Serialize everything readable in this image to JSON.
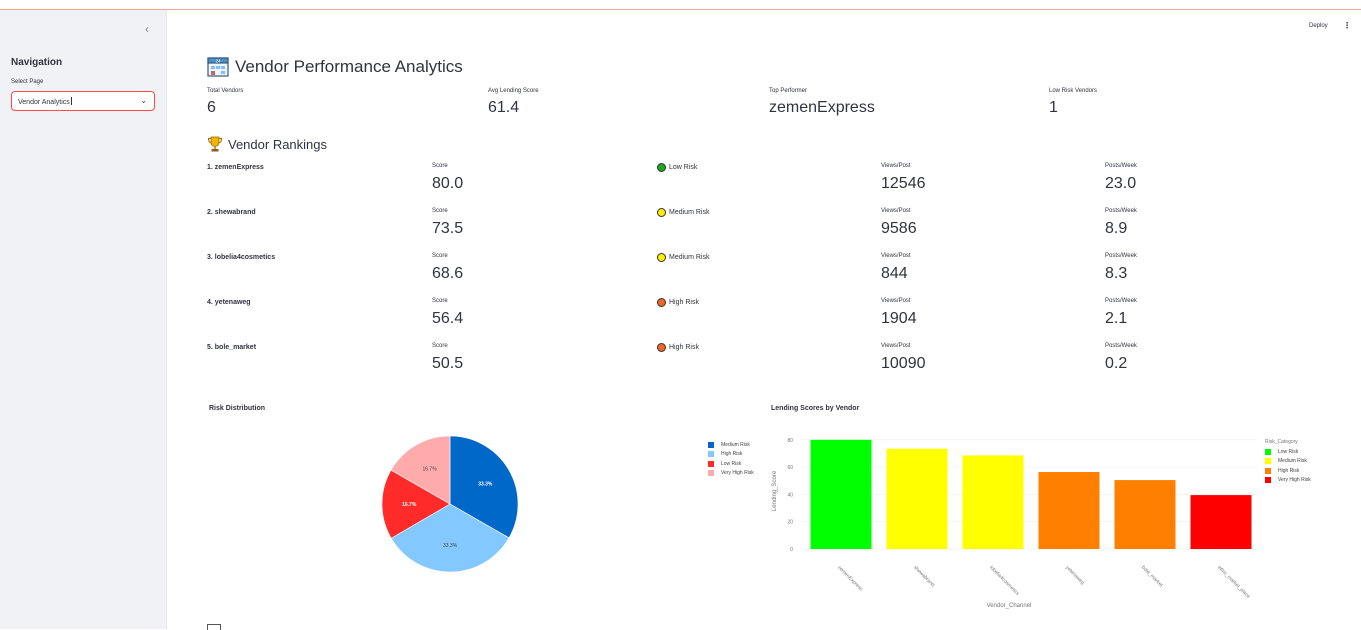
{
  "sidebar": {
    "title": "Navigation",
    "select_label": "Select Page",
    "select_value": "Vendor Analytics"
  },
  "header": {
    "deploy": "Deploy",
    "menu": "⋮"
  },
  "page_title": "Vendor Performance Analytics",
  "metrics": [
    {
      "label": "Total Vendors",
      "value": "6"
    },
    {
      "label": "Avg Lending Score",
      "value": "61.4"
    },
    {
      "label": "Top Performer",
      "value": "zemenExpress"
    },
    {
      "label": "Low Risk Vendors",
      "value": "1"
    }
  ],
  "rankings_title": "Vendor Rankings",
  "rankings": [
    {
      "name": "1. zemenExpress",
      "score_label": "Score",
      "score": "80.0",
      "risk": "Low Risk",
      "risk_color": "#1aaa1a",
      "views_label": "Views/Post",
      "views": "12546",
      "posts_label": "Posts/Week",
      "posts": "23.0"
    },
    {
      "name": "2. shewabrand",
      "score_label": "Score",
      "score": "73.5",
      "risk": "Medium Risk",
      "risk_color": "#ffee00",
      "views_label": "Views/Post",
      "views": "9586",
      "posts_label": "Posts/Week",
      "posts": "8.9"
    },
    {
      "name": "3. lobelia4cosmetics",
      "score_label": "Score",
      "score": "68.6",
      "risk": "Medium Risk",
      "risk_color": "#ffee00",
      "views_label": "Views/Post",
      "views": "844",
      "posts_label": "Posts/Week",
      "posts": "8.3"
    },
    {
      "name": "4. yetenaweg",
      "score_label": "Score",
      "score": "56.4",
      "risk": "High Risk",
      "risk_color": "#f26522",
      "views_label": "Views/Post",
      "views": "1904",
      "posts_label": "Posts/Week",
      "posts": "2.1"
    },
    {
      "name": "5. bole_market",
      "score_label": "Score",
      "score": "50.5",
      "risk": "High Risk",
      "risk_color": "#f26522",
      "views_label": "Views/Post",
      "views": "10090",
      "posts_label": "Posts/Week",
      "posts": "0.2"
    }
  ],
  "chart_data": [
    {
      "type": "pie",
      "title": "Risk Distribution",
      "categories": [
        "Medium Risk",
        "High Risk",
        "Low Risk",
        "Very High Risk"
      ],
      "values": [
        33.3,
        33.3,
        16.7,
        16.7
      ],
      "labels": [
        "33.3%",
        "33.3%",
        "16.7%",
        "16.7%"
      ],
      "colors": [
        "#0068c9",
        "#83c9ff",
        "#ff2b2b",
        "#ffabab"
      ],
      "legend": "top-left"
    },
    {
      "type": "bar",
      "title": "Lending Scores by Vendor",
      "xlabel": "Vendor_Channel",
      "ylabel": "Lending_Score",
      "ylim": [
        0,
        85
      ],
      "yticks": [
        0,
        20,
        40,
        60,
        80
      ],
      "categories": [
        "zemenExpress",
        "shewabrand",
        "lobelia4cosmetics",
        "yetenaweg",
        "bole_market",
        "ethio_market_place"
      ],
      "values": [
        80.0,
        73.5,
        68.6,
        56.4,
        50.5,
        39.5
      ],
      "bar_colors": [
        "#00ff00",
        "#ffff00",
        "#ffff00",
        "#ff7f00",
        "#ff7f00",
        "#ff0000"
      ],
      "legend_title": "Risk_Category",
      "legend_entries": [
        {
          "name": "Low Risk",
          "color": "#00ff00"
        },
        {
          "name": "Medium Risk",
          "color": "#ffff00"
        },
        {
          "name": "High Risk",
          "color": "#ff7f00"
        },
        {
          "name": "Very High Risk",
          "color": "#ff0000"
        }
      ],
      "legend": "right"
    }
  ]
}
